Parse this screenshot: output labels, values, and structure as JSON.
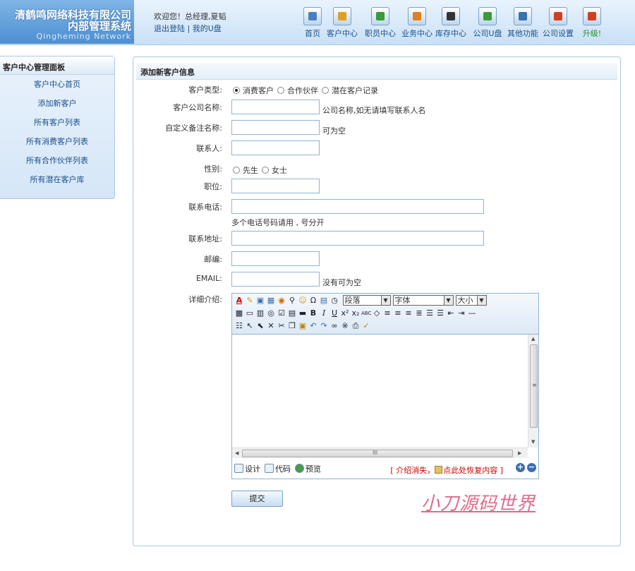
{
  "header": {
    "logo_line1": "清鹤鸣网络科技有限公司",
    "logo_line2": "内部管理系统",
    "logo_line3": "Qingheming Network",
    "welcome": "欢迎您！总经理,夏韬",
    "logout_link": "退出登陆",
    "link_sep": " | ",
    "mydisk_link": "我的U盘",
    "nav": [
      {
        "label": "首页",
        "icon": "home-icon",
        "color": "#4a7fc0"
      },
      {
        "label": "客户中心",
        "icon": "customer-icon",
        "color": "#e0a020"
      },
      {
        "label": "职员中心",
        "icon": "staff-icon",
        "color": "#3b9a3b"
      },
      {
        "label": "业务中心",
        "icon": "business-icon",
        "color": "#e08020"
      },
      {
        "label": "库存中心",
        "icon": "inventory-icon",
        "color": "#333333"
      },
      {
        "label": "公司U盘",
        "icon": "disk-icon",
        "color": "#3b9a3b"
      },
      {
        "label": "其他功能",
        "icon": "other-icon",
        "color": "#3a6fb0"
      },
      {
        "label": "公司设置",
        "icon": "settings-icon",
        "color": "#d04020"
      },
      {
        "label": "升级!",
        "icon": "upgrade-icon",
        "color": "#d04020",
        "label_color": "#2a8a2a"
      }
    ]
  },
  "sidebar": {
    "title": "客户中心管理面板",
    "items": [
      "客户中心首页",
      "添加新客户",
      "所有客户列表",
      "所有消费客户列表",
      "所有合作伙伴列表",
      "所有潜在客户库"
    ]
  },
  "form": {
    "title": "添加新客户信息",
    "type_label": "客户类型:",
    "type_options": [
      "消费客户",
      "合作伙伴",
      "潜在客户记录"
    ],
    "type_selected": 0,
    "company_label": "客户公司名称:",
    "company_hint": "公司名称,如无请填写联系人名",
    "remark_label": "自定义备注名称:",
    "remark_hint": "可为空",
    "contact_label": "联系人:",
    "gender_label": "性别:",
    "gender_options": [
      "先生",
      "女士"
    ],
    "position_label": "职位:",
    "phone_label": "联系电话:",
    "phone_hint": "多个电话号码请用 , 号分开",
    "address_label": "联系地址:",
    "zip_label": "邮编:",
    "email_label": "EMAIL:",
    "email_hint": "没有可为空",
    "detail_label": "详细介绍:",
    "submit_label": "提交"
  },
  "editor": {
    "paragraph_select": "段落",
    "font_select": "字体",
    "size_select": "大小",
    "mode_design": "设计",
    "mode_code": "代码",
    "mode_preview": "预览",
    "restore_text": "[ 介绍消失，",
    "restore_link": "点此处恢复内容 ]",
    "scroll_grip": "≡",
    "hscroll_grip": "III"
  },
  "watermark": "小刀源码世界"
}
